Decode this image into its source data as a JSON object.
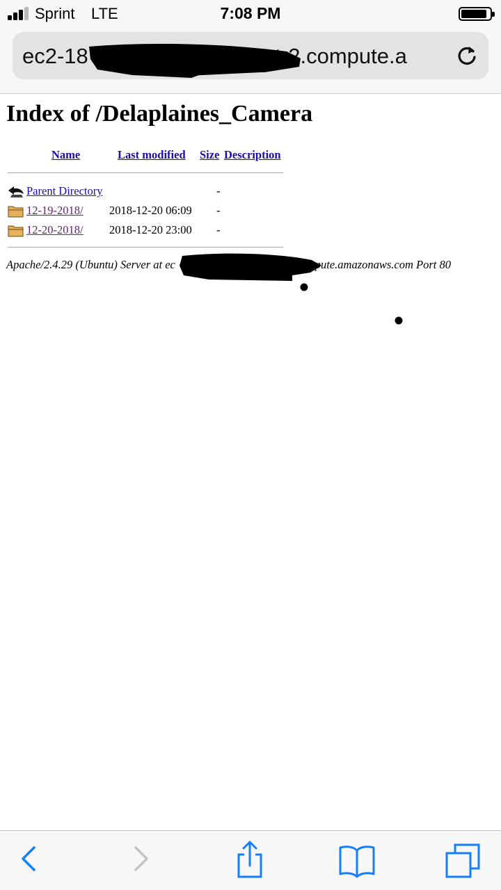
{
  "status_bar": {
    "carrier": "Sprint",
    "network": "LTE",
    "time": "7:08 PM",
    "signal_bars_active": 3,
    "signal_bars_total": 4,
    "battery_icon": "battery-icon"
  },
  "address_bar": {
    "url_start": "ec2-18",
    "url_end": "st-2.compute.a",
    "reload_icon": "reload-icon"
  },
  "page": {
    "title": "Index of /Delaplaines_Camera",
    "columns": {
      "name": "Name",
      "last_modified": "Last modified",
      "size": "Size",
      "description": "Description"
    },
    "parent": {
      "label": "Parent Directory",
      "size": "-",
      "icon": "back-arrow-icon"
    },
    "entries": [
      {
        "name": "12-19-2018/",
        "modified": "2018-12-20 06:09",
        "size": "-",
        "icon": "folder-icon"
      },
      {
        "name": "12-20-2018/",
        "modified": "2018-12-20 23:00",
        "size": "-",
        "icon": "folder-icon"
      }
    ],
    "server_signature": {
      "prefix": "Apache/2.4.29 (Ubuntu) Server at ec",
      "suffix": "mpute.amazonaws.com Port 80"
    }
  },
  "toolbar": {
    "back_icon": "back-chevron-icon",
    "forward_icon": "forward-chevron-icon",
    "share_icon": "share-icon",
    "bookmarks_icon": "bookmarks-icon",
    "tabs_icon": "tabs-icon"
  },
  "colors": {
    "link": "#1a0dab",
    "visited_link": "#61246f",
    "ios_blue": "#157efb",
    "chrome_bg": "#f7f7f7",
    "address_bg": "#e3e3e5"
  }
}
